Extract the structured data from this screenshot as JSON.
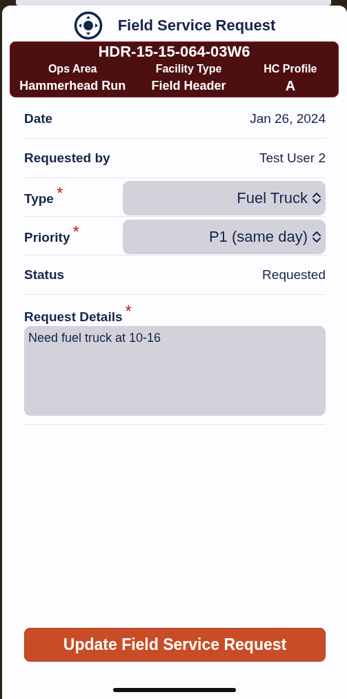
{
  "title": "Field Service Request",
  "header": {
    "code": "HDR-15-15-064-03W6",
    "columns": [
      {
        "label": "Ops Area",
        "value": "Hammerhead Run"
      },
      {
        "label": "Facility Type",
        "value": "Field Header"
      },
      {
        "label": "HC Profile",
        "value": "A"
      }
    ]
  },
  "fields": [
    {
      "kind": "text",
      "label": "Date",
      "value": "Jan 26, 2024"
    },
    {
      "kind": "text",
      "label": "Requested by",
      "value": "Test User 2"
    },
    {
      "kind": "select",
      "label": "Type",
      "value": "Fuel Truck",
      "required_mark": "*"
    },
    {
      "kind": "select",
      "label": "Priority",
      "value": "P1 (same day)",
      "required_mark": "*"
    },
    {
      "kind": "text",
      "label": "Status",
      "value": "Requested"
    },
    {
      "kind": "textarea",
      "label": "Request Details",
      "value": "Need fuel truck at 10-16",
      "required_mark": "*"
    }
  ],
  "button": "Update Field Service Request"
}
